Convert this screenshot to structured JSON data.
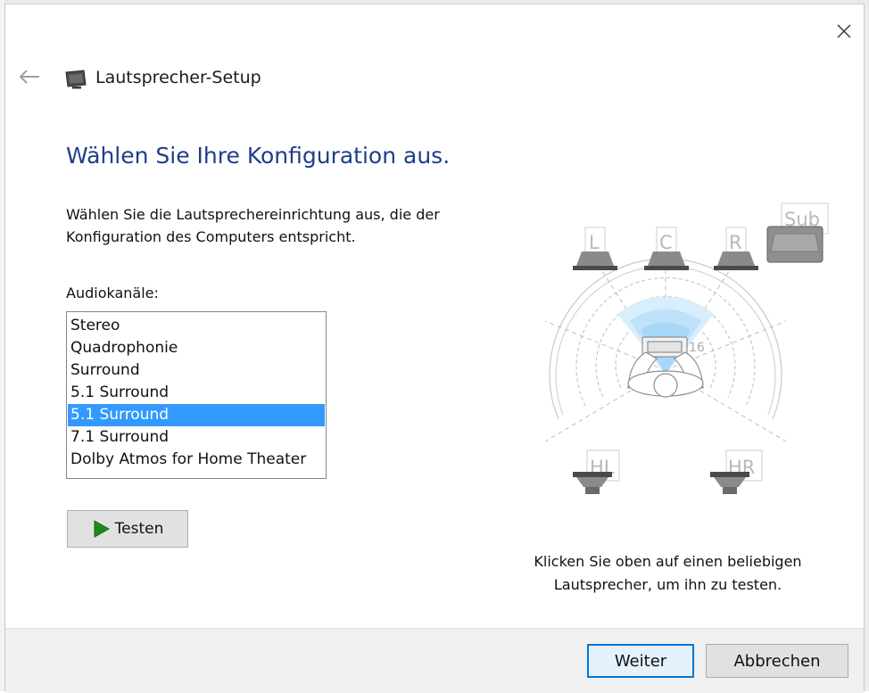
{
  "window": {
    "title": "Lautsprecher-Setup",
    "icon": "monitor-speaker-icon"
  },
  "page": {
    "heading": "Wählen Sie Ihre Konfiguration aus.",
    "description": "Wählen Sie die Lautsprechereinrichtung aus, die der Konfiguration des Computers entspricht.",
    "list_label": "Audiokanäle:"
  },
  "channels": {
    "items": [
      "Stereo",
      "Quadrophonie",
      "Surround",
      "5.1 Surround",
      "5.1 Surround",
      "7.1 Surround",
      "Dolby Atmos for Home Theater"
    ],
    "selected_index": 4
  },
  "test_button": {
    "label": "Testen",
    "icon": "play-icon"
  },
  "diagram": {
    "speakers": {
      "left": "L",
      "center": "C",
      "right": "R",
      "sub": "Sub",
      "rear_left": "HL",
      "rear_right": "HR"
    },
    "hint": "Klicken Sie oben auf einen beliebigen Lautsprecher, um ihn zu testen."
  },
  "footer": {
    "next_label": "Weiter",
    "cancel_label": "Abbrechen"
  },
  "colors": {
    "heading": "#1f3d8a",
    "selection": "#3399ff",
    "primary_border": "#0078d7"
  }
}
